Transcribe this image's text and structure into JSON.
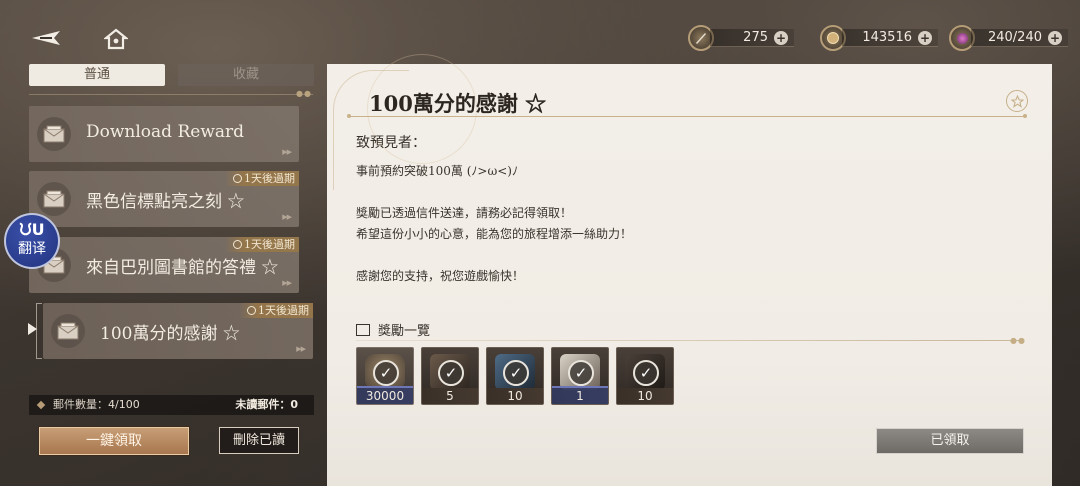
{
  "topbar": {
    "back_icon": "back-arrow-icon",
    "home_icon": "home-icon",
    "currencies": [
      {
        "icon": "stamina-pen-icon",
        "value": "275"
      },
      {
        "icon": "coin-icon",
        "value": "143516"
      },
      {
        "icon": "energy-orb-icon",
        "value": "240/240"
      }
    ]
  },
  "tabs": {
    "normal": "普通",
    "favorites": "收藏"
  },
  "mails": [
    {
      "title": "Download Reward",
      "expiry": ""
    },
    {
      "title": "黑色信標點亮之刻 ☆",
      "expiry": "1天後過期"
    },
    {
      "title": "來自巴別圖書館的答禮 ☆",
      "expiry": "1天後過期"
    },
    {
      "title": "100萬分的感謝 ☆",
      "expiry": "1天後過期"
    }
  ],
  "footer": {
    "mail_count_label": "郵件數量：",
    "mail_count_value": "4/100",
    "unread_label": "未讀郵件：0",
    "claim_all": "一鍵領取",
    "delete_read": "刪除已讀"
  },
  "detail": {
    "title": "100萬分的感謝 ☆",
    "greeting": "致預見者：",
    "body": "事前預約突破100萬 (ﾉ>ω<)ﾉ\n\n獎勵已透過信件送達，請務必記得領取！\n希望這份小小的心意，能為您的旅程增添一絲助力！\n\n感謝您的支持，祝您遊戲愉快！",
    "reward_header": "獎勵一覽",
    "rewards": [
      {
        "icon": "coin-bundle-icon",
        "qty": "30000"
      },
      {
        "icon": "material-crate-icon",
        "qty": "5"
      },
      {
        "icon": "blue-crystal-icon",
        "qty": "10"
      },
      {
        "icon": "scroll-ticket-icon",
        "qty": "1"
      },
      {
        "icon": "quill-pen-icon",
        "qty": "10"
      }
    ],
    "claimed_button": "已領取"
  },
  "translate_badge": {
    "symbol": "ᙀU",
    "label": "翻译"
  }
}
